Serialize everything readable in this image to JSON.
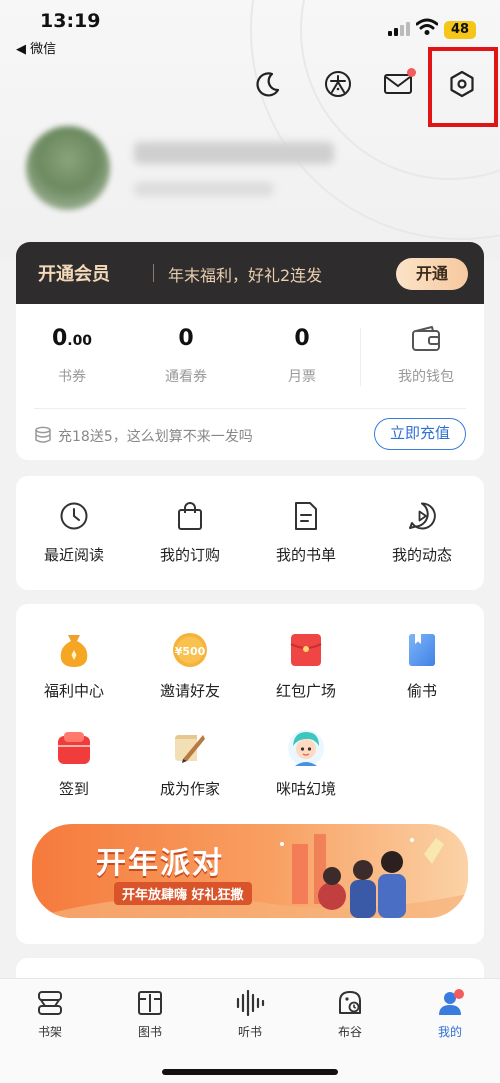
{
  "status_bar": {
    "time": "13:19",
    "back_app": "◀ 微信",
    "battery": "48"
  },
  "top_icons": [
    "moon-icon",
    "tai-icon",
    "mail-icon",
    "settings-icon"
  ],
  "vip": {
    "title": "开通会员",
    "promo": "年末福利，好礼2连发",
    "button": "开通"
  },
  "wallet": {
    "items": [
      {
        "value": "0",
        "decimal": ".00",
        "label": "书券"
      },
      {
        "value": "0",
        "decimal": "",
        "label": "通看券"
      },
      {
        "value": "0",
        "decimal": "",
        "label": "月票"
      }
    ],
    "wallet_label": "我的钱包",
    "recharge_text": "充18送5，这么划算不来一发吗",
    "recharge_button": "立即充值"
  },
  "quick": [
    {
      "label": "最近阅读",
      "icon": "clock-icon"
    },
    {
      "label": "我的订购",
      "icon": "bag-icon"
    },
    {
      "label": "我的书单",
      "icon": "booklist-icon"
    },
    {
      "label": "我的动态",
      "icon": "activity-icon"
    }
  ],
  "services": [
    {
      "label": "福利中心",
      "icon": "moneybag-icon"
    },
    {
      "label": "邀请好友",
      "icon": "coin-500-icon",
      "badge": "¥500"
    },
    {
      "label": "红包广场",
      "icon": "red-envelope-icon"
    },
    {
      "label": "偷书",
      "icon": "book-blue-icon"
    },
    {
      "label": "签到",
      "icon": "checkin-icon"
    },
    {
      "label": "成为作家",
      "icon": "quill-icon"
    },
    {
      "label": "咪咕幻境",
      "icon": "avatar-character-icon"
    }
  ],
  "banner": {
    "title": "开年派对",
    "subtitle": "开年放肆嗨 好礼狂撒"
  },
  "tabs": [
    {
      "label": "书架",
      "icon": "bookshelf-icon"
    },
    {
      "label": "图书",
      "icon": "book-icon"
    },
    {
      "label": "听书",
      "icon": "audio-icon"
    },
    {
      "label": "布谷",
      "icon": "bugu-icon"
    },
    {
      "label": "我的",
      "icon": "profile-icon",
      "active": true
    }
  ],
  "colors": {
    "accent": "#2f6fd6",
    "vip_bg": "#2e2c2d",
    "vip_gold": "#f3d9b8",
    "highlight": "#e01515"
  }
}
